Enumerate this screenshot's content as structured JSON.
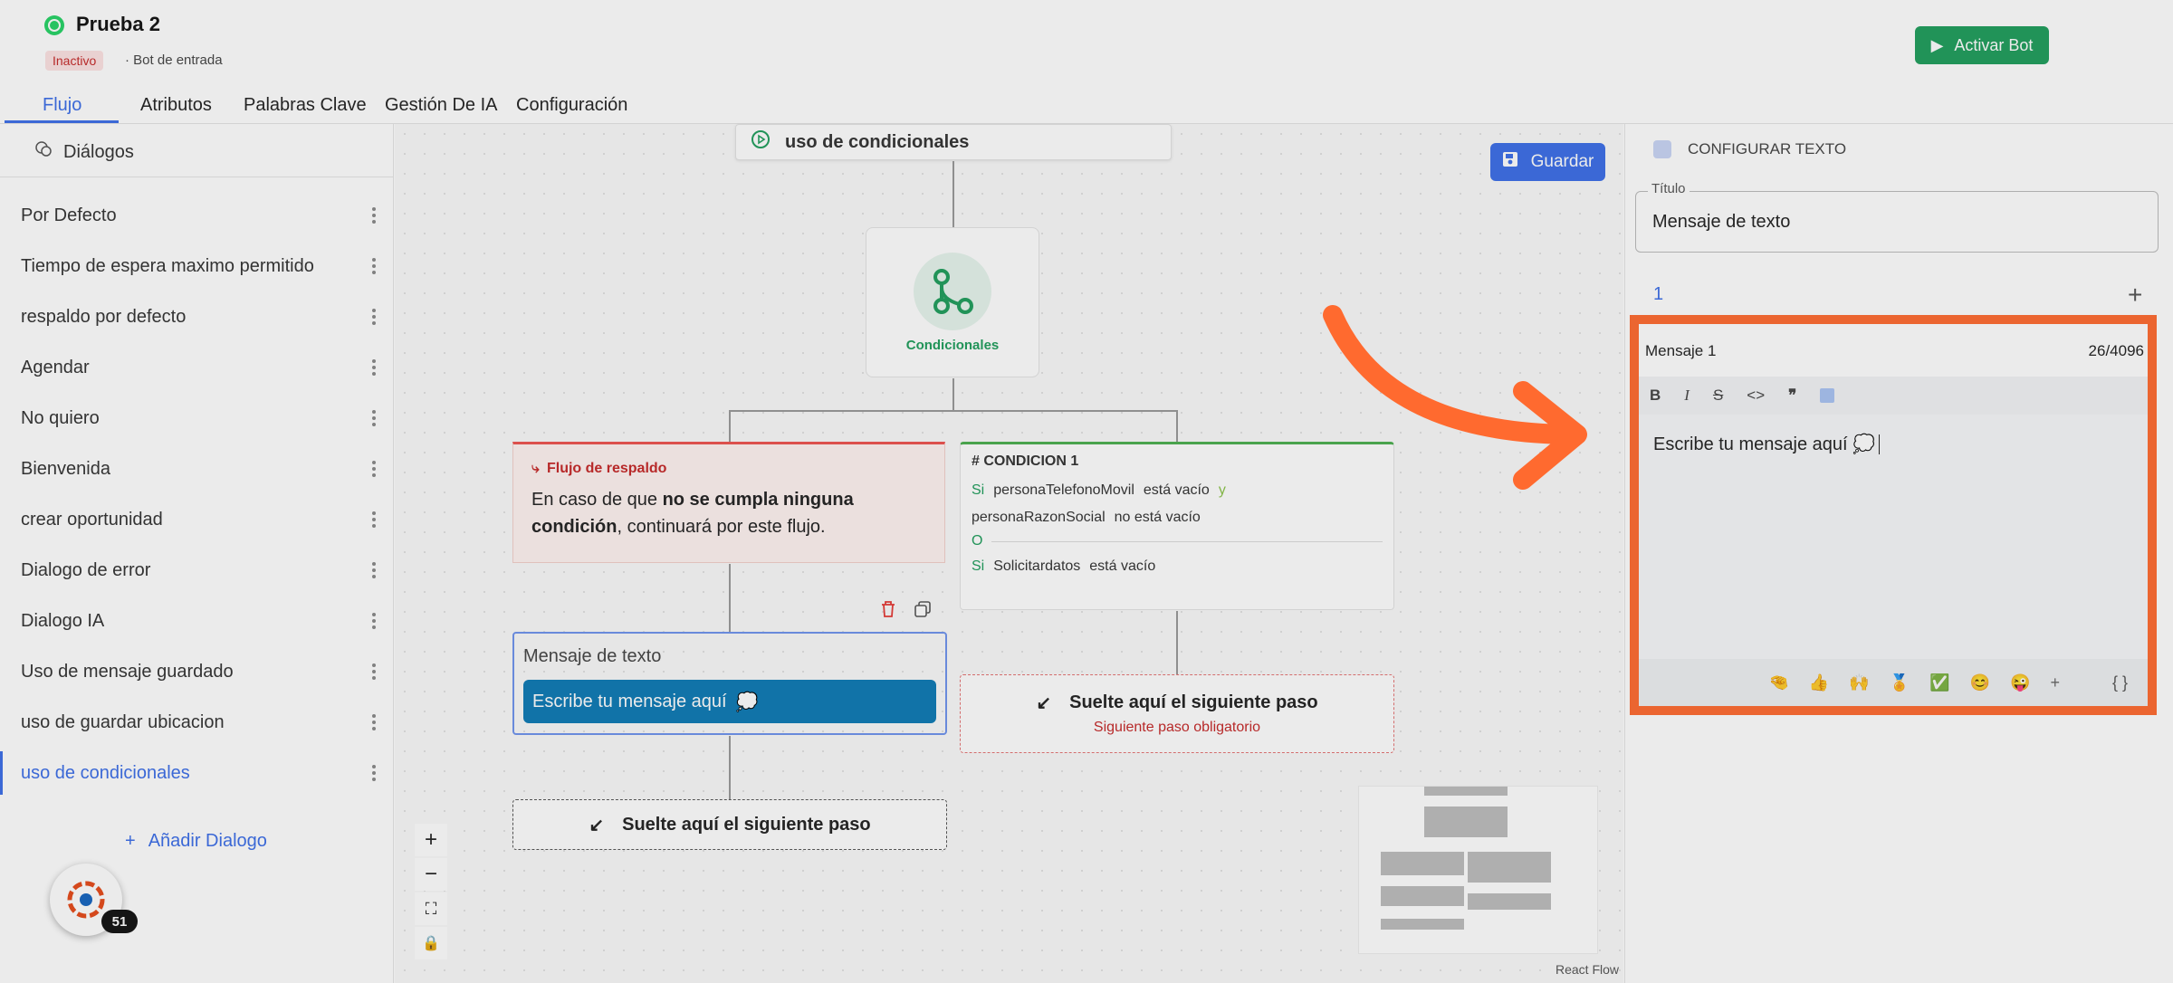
{
  "header": {
    "bot_name": "Prueba 2",
    "status": "Inactivo",
    "bot_type": "Bot de entrada",
    "activate_label": "Activar Bot"
  },
  "tabs": [
    "Flujo",
    "Atributos",
    "Palabras Clave",
    "Gestión De IA",
    "Configuración"
  ],
  "sidebar": {
    "header": "Diálogos",
    "items": [
      "Por Defecto",
      "Tiempo de espera maximo permitido",
      "respaldo por defecto",
      "Agendar",
      "No quiero",
      "Bienvenida",
      "crear oportunidad",
      "Dialogo de error",
      "Dialogo IA",
      "Uso de mensaje guardado",
      "uso de guardar ubicacion",
      "uso de condicionales"
    ],
    "active_index": 11,
    "add_label": "Añadir Dialogo",
    "notification_count": "51"
  },
  "canvas": {
    "save_label": "Guardar",
    "start_node": "uso de condicionales",
    "conditional_label": "Condicionales",
    "fallback": {
      "title": "Flujo de respaldo",
      "text_pre": "En caso de que ",
      "text_bold": "no se cumpla ninguna condición",
      "text_post": ", continuará por este flujo."
    },
    "condition": {
      "title": "# CONDICION 1",
      "si": "Si",
      "y": "y",
      "o": "O",
      "field1": "personaTelefonoMovil",
      "op1": "está vacío",
      "field2": "personaRazonSocial",
      "op2": "no está vacío",
      "field3": "Solicitardatos",
      "op3": "está vacío"
    },
    "text_node": {
      "title": "Mensaje de texto",
      "bubble": "Escribe tu mensaje aquí"
    },
    "drop_right_title": "Suelte aquí el siguiente paso",
    "drop_right_sub": "Siguiente paso obligatorio",
    "drop_left_title": "Suelte aquí el siguiente paso",
    "attribution": "React Flow"
  },
  "panel": {
    "header": "CONFIGURAR TEXTO",
    "title_legend": "Título",
    "title_value": "Mensaje de texto",
    "message_number": "1",
    "editor_label": "Mensaje 1",
    "char_count": "26/4096",
    "editor_text": "Escribe tu mensaje aquí 💭",
    "variables_label": "{ }"
  },
  "colors": {
    "accent": "#3b6ee8",
    "success": "#1f9d5c",
    "highlight": "#ff6a2f"
  }
}
